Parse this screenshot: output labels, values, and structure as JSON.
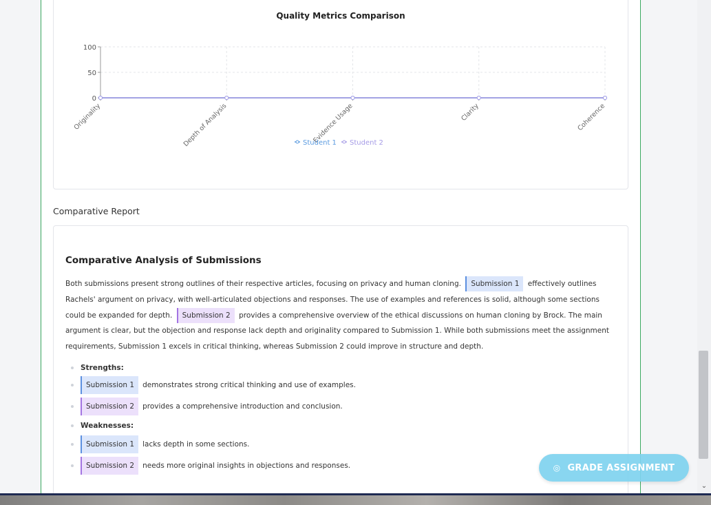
{
  "chart": {
    "title": "Quality Metrics Comparison",
    "legend": [
      "Student 1",
      "Student 2"
    ]
  },
  "chart_data": {
    "type": "line",
    "title": "Quality Metrics Comparison",
    "categories": [
      "Originality",
      "Depth of Analysis",
      "Evidence Usage",
      "Clarity",
      "Coherence"
    ],
    "series": [
      {
        "name": "Student 1",
        "values": [
          0,
          0,
          0,
          0,
          0
        ],
        "color": "#5b9be0"
      },
      {
        "name": "Student 2",
        "values": [
          0,
          0,
          0,
          0,
          0
        ],
        "color": "#a59be6"
      }
    ],
    "yticks": [
      0,
      50,
      100
    ],
    "ylim": [
      0,
      100
    ],
    "grid": true,
    "legend_position": "bottom"
  },
  "report": {
    "section_label": "Comparative Report",
    "title": "Comparative Analysis of Submissions",
    "p1": "Both submissions present strong outlines of their respective articles, focusing on privacy and human cloning.",
    "tag1": "Submission 1",
    "p2": "effectively outlines Rachels' argument on privacy, with well-articulated objections and responses. The use of examples and references is solid, although some sections could be expanded for depth.",
    "tag2": "Submission 2",
    "p3": "provides a comprehensive overview of the ethical discussions on human cloning by Brock. The main argument is clear, but the objection and response lack depth and originality compared to Submission 1. While both submissions meet the assignment requirements, Submission 1 excels in critical thinking, whereas Submission 2 could improve in structure and depth.",
    "strengths_label": "Strengths:",
    "strengths": [
      {
        "tag": "Submission 1",
        "text": "demonstrates strong critical thinking and use of examples."
      },
      {
        "tag": "Submission 2",
        "text": "provides a comprehensive introduction and conclusion."
      }
    ],
    "weaknesses_label": "Weaknesses:",
    "weaknesses": [
      {
        "tag": "Submission 1",
        "text": "lacks depth in some sections."
      },
      {
        "tag": "Submission 2",
        "text": "needs more original insights in objections and responses."
      }
    ]
  },
  "actions": {
    "grade_label": "GRADE ASSIGNMENT",
    "grade_icon": "circle-check-icon"
  }
}
